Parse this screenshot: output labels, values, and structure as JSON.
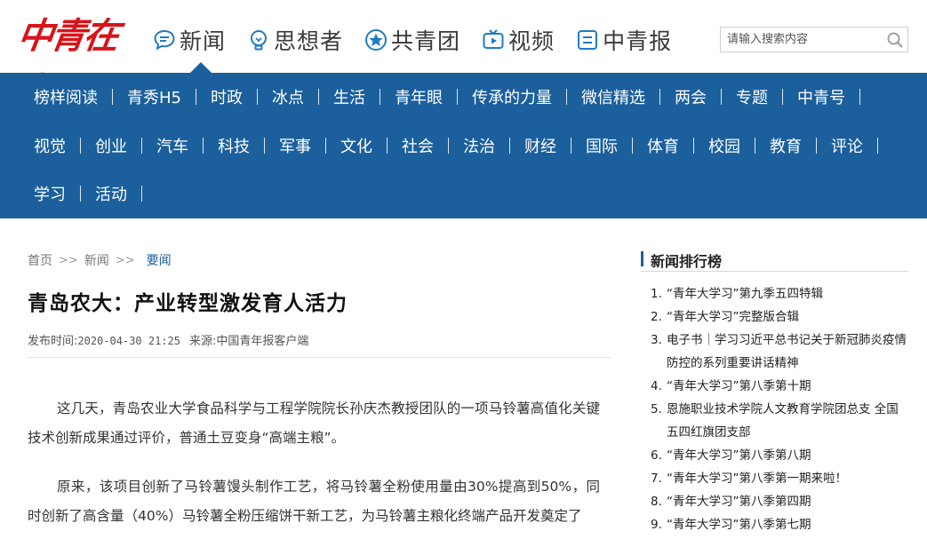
{
  "header": {
    "logo_text": "中青在线",
    "topnav": [
      {
        "label": "新闻",
        "icon": "chat-bubble-icon"
      },
      {
        "label": "思想者",
        "icon": "lightbulb-icon"
      },
      {
        "label": "共青团",
        "icon": "star-emblem-icon"
      },
      {
        "label": "视频",
        "icon": "tv-play-icon"
      },
      {
        "label": "中青报",
        "icon": "newspaper-icon"
      }
    ],
    "search_placeholder": "请输入搜索内容"
  },
  "colors": {
    "accent_blue": "#1b5f9c",
    "logo_red": "#d8131a",
    "topnav_icon": "#1f7bc4"
  },
  "nav": {
    "row1": [
      "榜样阅读",
      "青秀H5",
      "时政",
      "冰点",
      "生活",
      "青年眼",
      "传承的力量",
      "微信精选",
      "两会",
      "专题",
      "中青号"
    ],
    "row2": [
      "视觉",
      "创业",
      "汽车",
      "科技",
      "军事",
      "文化",
      "社会",
      "法治",
      "财经",
      "国际",
      "体育",
      "校园",
      "教育",
      "评论"
    ],
    "row3": [
      "学习",
      "活动"
    ]
  },
  "breadcrumb": {
    "home": "首页",
    "section": "新闻",
    "current": "要闻",
    "separator": ">>"
  },
  "article": {
    "title": "青岛农大：产业转型激发育人活力",
    "time_label": "发布时间:",
    "time": "2020-04-30 21:25",
    "source_label": "来源:",
    "source": "中国青年报客户端",
    "paragraphs": [
      "这几天，青岛农业大学食品科学与工程学院院长孙庆杰教授团队的一项马铃薯高值化关键技术创新成果通过评价，普通土豆变身“高端主粮”。",
      "原来，该项目创新了马铃薯馒头制作工艺，将马铃薯全粉使用量由30%提高到50%，同时创新了高含量（40%）马铃薯全粉压缩饼干新工艺，为马铃薯主粮化终端产品开发奠定了"
    ]
  },
  "sidebar": {
    "title": "新闻排行榜",
    "items": [
      {
        "num": "1.",
        "text": "“青年大学习”第九季五四特辑"
      },
      {
        "num": "2.",
        "text": "“青年大学习”完整版合辑"
      },
      {
        "num": "3.",
        "text": "电子书｜学习习近平总书记关于新冠肺炎疫情防控的系列重要讲话精神"
      },
      {
        "num": "4.",
        "text": "“青年大学习”第八季第十期"
      },
      {
        "num": "5.",
        "text": "恩施职业技术学院人文教育学院团总支 全国五四红旗团支部"
      },
      {
        "num": "6.",
        "text": "“青年大学习”第八季第八期"
      },
      {
        "num": "7.",
        "text": "“青年大学习”第八季第一期来啦！"
      },
      {
        "num": "8.",
        "text": "“青年大学习”第八季第四期"
      },
      {
        "num": "9.",
        "text": "“青年大学习”第八季第七期"
      }
    ]
  }
}
